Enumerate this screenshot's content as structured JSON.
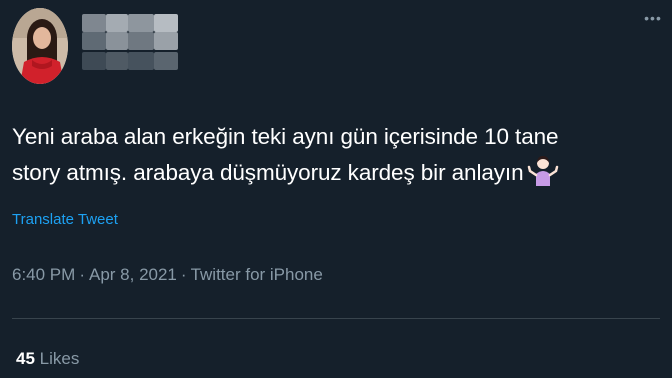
{
  "tweet": {
    "text_line_1": "Yeni araba alan erkeğin teki aynı gün içerisinde 10 tane",
    "text_line_2": "story atmış. arabaya düşmüyoruz kardeş bir anlayın",
    "emoji": "woman-shrugging-emoji",
    "translate_label": "Translate Tweet",
    "time": "6:40 PM",
    "date": "Apr 8, 2021",
    "separator": "·",
    "source": "Twitter for iPhone",
    "likes_count": "45",
    "likes_label": "Likes"
  },
  "author": {
    "avatar_icon": "profile-photo",
    "name_obscured": true
  },
  "colors": {
    "background": "#15202b",
    "text": "#ffffff",
    "secondary": "#8899a6",
    "link": "#1da1f2",
    "divider": "#38444d"
  },
  "menu": {
    "more_icon": "more-options-icon"
  }
}
